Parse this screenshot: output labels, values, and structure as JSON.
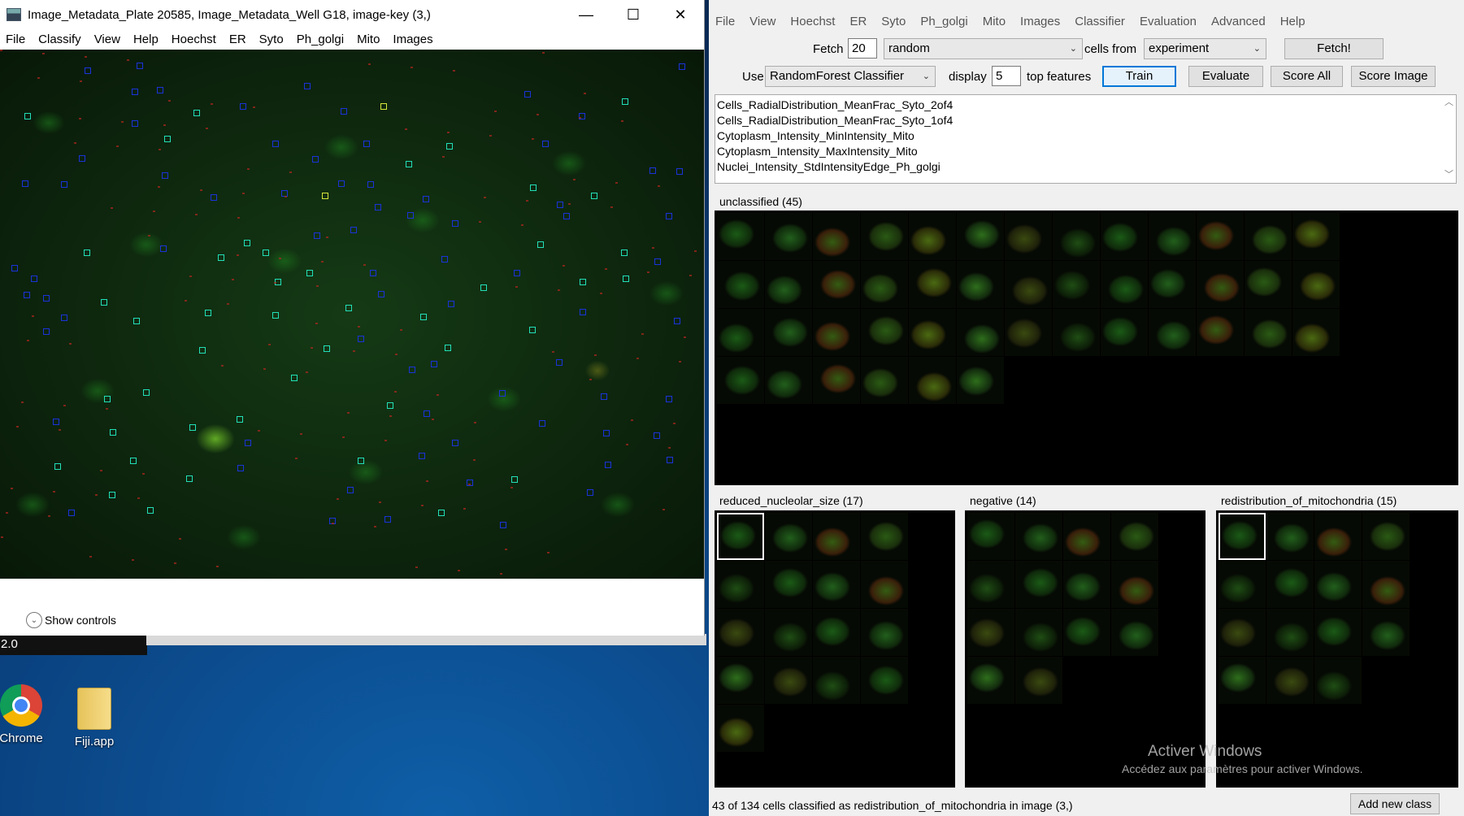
{
  "desktop": {
    "version_text": "2.0",
    "icons": [
      {
        "label": "Chrome",
        "icon": "chrome-icon"
      },
      {
        "label": "Fiji.app",
        "icon": "folder-icon"
      }
    ]
  },
  "image_window": {
    "title": "Image_Metadata_Plate 20585, Image_Metadata_Well G18, image-key (3,)",
    "controls": {
      "minimize": "—",
      "maximize": "☐",
      "close": "✕"
    },
    "menu": [
      "File",
      "Classify",
      "View",
      "Help",
      "Hoechst",
      "ER",
      "Syto",
      "Ph_golgi",
      "Mito",
      "Images"
    ],
    "show_controls_label": "Show controls",
    "marker_colors": {
      "blue": "#1a33d9",
      "cyan": "#22e0b8",
      "yellow": "#d6e63a"
    }
  },
  "classifier": {
    "menu": [
      "File",
      "View",
      "Hoechst",
      "ER",
      "Syto",
      "Ph_golgi",
      "Mito",
      "Images",
      "Classifier",
      "Evaluation",
      "Advanced",
      "Help"
    ],
    "fetch": {
      "label": "Fetch",
      "count": "20",
      "method": "random",
      "cells_from_label": "cells from",
      "source": "experiment",
      "button": "Fetch!"
    },
    "train": {
      "use_label": "Use",
      "classifier": "RandomForest Classifier",
      "display_label": "display",
      "display_count": "5",
      "top_features_label": "top features",
      "train_button": "Train",
      "evaluate_button": "Evaluate",
      "score_all_button": "Score All",
      "score_image_button": "Score Image"
    },
    "features": [
      "Cells_RadialDistribution_MeanFrac_Syto_2of4",
      "Cells_RadialDistribution_MeanFrac_Syto_1of4",
      "Cytoplasm_Intensity_MinIntensity_Mito",
      "Cytoplasm_Intensity_MaxIntensity_Mito",
      "Nuclei_Intensity_StdIntensityEdge_Ph_golgi"
    ],
    "bins": {
      "unclassified": {
        "label": "unclassified (45)",
        "count": 45
      },
      "reduced": {
        "label": "reduced_nucleolar_size (17)",
        "count": 17
      },
      "negative": {
        "label": "negative (14)",
        "count": 14
      },
      "redistribution": {
        "label": "redistribution_of_mitochondria (15)",
        "count": 15
      }
    },
    "status": "43 of 134 cells classified as redistribution_of_mitochondria in image (3,)",
    "add_class_button": "Add new class",
    "watermark": {
      "title": "Activer Windows",
      "subtitle": "Accédez aux paramètres pour activer Windows."
    }
  }
}
